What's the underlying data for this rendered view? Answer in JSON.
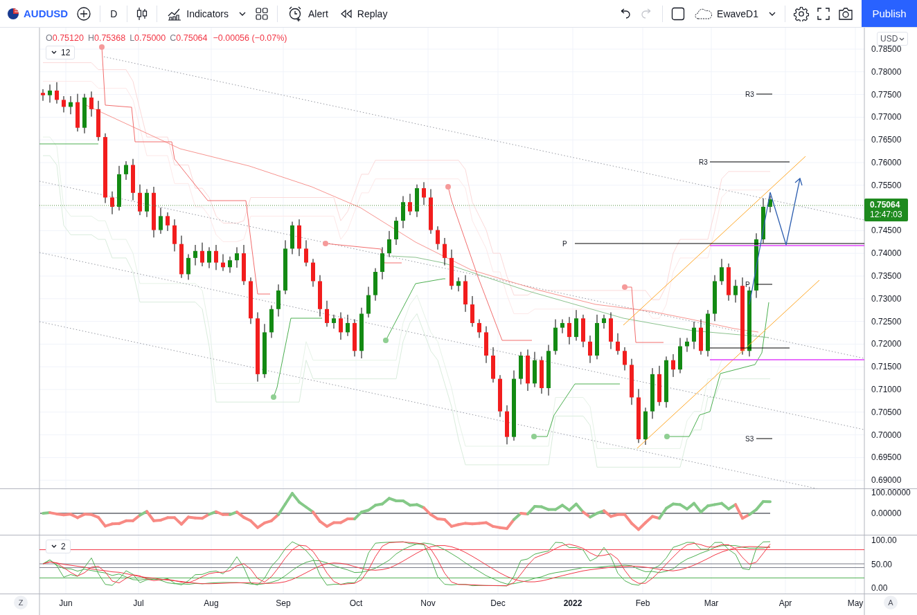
{
  "toolbar": {
    "symbol": "AUDUSD",
    "interval": "D",
    "indicators_label": "Indicators",
    "alert_label": "Alert",
    "replay_label": "Replay",
    "undo": {
      "disabled": false
    },
    "redo": {
      "disabled": true
    },
    "layout_name": "EwaveD1",
    "publish_label": "Publish"
  },
  "legend": {
    "items": [
      {
        "key": "O",
        "value": "0.75120"
      },
      {
        "key": "H",
        "value": "0.75368"
      },
      {
        "key": "L",
        "value": "0.75000"
      },
      {
        "key": "C",
        "value": "0.75064"
      }
    ],
    "change": "−0.00056 (−0.07%)",
    "indicators_count": "12"
  },
  "main_chart": {
    "currency": "USD",
    "last_price": "0.75064",
    "countdown": "12:47:03",
    "level_labels": [
      "R3",
      "R3",
      "P",
      "P",
      "S3"
    ],
    "price_labels": [
      "0.78500",
      "0.78000",
      "0.77500",
      "0.77000",
      "0.76500",
      "0.76000",
      "0.75500",
      "0.74500",
      "0.74000",
      "0.73500",
      "0.73000",
      "0.72500",
      "0.72000",
      "0.71500",
      "0.71000",
      "0.70500",
      "0.70000",
      "0.69500",
      "0.69000"
    ]
  },
  "pane_1": {
    "axis_labels": [
      "100.00000",
      "0.00000"
    ]
  },
  "pane_2": {
    "collapse_count": "2",
    "axis_labels": [
      "100.00",
      "50.00",
      "0.00"
    ]
  },
  "time_axis": {
    "labels": [
      "Jun",
      "Jul",
      "Aug",
      "Sep",
      "Oct",
      "Nov",
      "Dec",
      "2022",
      "Feb",
      "Mar",
      "Apr",
      "May"
    ],
    "left_button": "Z",
    "right_button": "A"
  }
}
